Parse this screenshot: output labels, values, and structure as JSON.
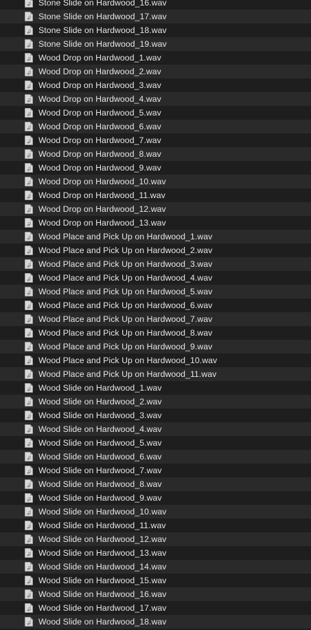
{
  "window": {
    "view": "list"
  },
  "files": [
    {
      "name": "Stone Slide on Hardwood_16.wav",
      "icon": "audio-file-icon"
    },
    {
      "name": "Stone Slide on Hardwood_17.wav",
      "icon": "audio-file-icon"
    },
    {
      "name": "Stone Slide on Hardwood_18.wav",
      "icon": "audio-file-icon"
    },
    {
      "name": "Stone Slide on Hardwood_19.wav",
      "icon": "audio-file-icon"
    },
    {
      "name": "Wood Drop on Hardwood_1.wav",
      "icon": "audio-file-icon"
    },
    {
      "name": "Wood Drop on Hardwood_2.wav",
      "icon": "audio-file-icon"
    },
    {
      "name": "Wood Drop on Hardwood_3.wav",
      "icon": "audio-file-icon"
    },
    {
      "name": "Wood Drop on Hardwood_4.wav",
      "icon": "audio-file-icon"
    },
    {
      "name": "Wood Drop on Hardwood_5.wav",
      "icon": "audio-file-icon"
    },
    {
      "name": "Wood Drop on Hardwood_6.wav",
      "icon": "audio-file-icon"
    },
    {
      "name": "Wood Drop on Hardwood_7.wav",
      "icon": "audio-file-icon"
    },
    {
      "name": "Wood Drop on Hardwood_8.wav",
      "icon": "audio-file-icon"
    },
    {
      "name": "Wood Drop on Hardwood_9.wav",
      "icon": "audio-file-icon"
    },
    {
      "name": "Wood Drop on Hardwood_10.wav",
      "icon": "audio-file-icon"
    },
    {
      "name": "Wood Drop on Hardwood_11.wav",
      "icon": "audio-file-icon"
    },
    {
      "name": "Wood Drop on Hardwood_12.wav",
      "icon": "audio-file-icon"
    },
    {
      "name": "Wood Drop on Hardwood_13.wav",
      "icon": "audio-file-icon"
    },
    {
      "name": "Wood Place and Pick Up on Hardwood_1.wav",
      "icon": "audio-file-icon"
    },
    {
      "name": "Wood Place and Pick Up on Hardwood_2.wav",
      "icon": "audio-file-icon"
    },
    {
      "name": "Wood Place and Pick Up on Hardwood_3.wav",
      "icon": "audio-file-icon"
    },
    {
      "name": "Wood Place and Pick Up on Hardwood_4.wav",
      "icon": "audio-file-icon"
    },
    {
      "name": "Wood Place and Pick Up on Hardwood_5.wav",
      "icon": "audio-file-icon"
    },
    {
      "name": "Wood Place and Pick Up on Hardwood_6.wav",
      "icon": "audio-file-icon"
    },
    {
      "name": "Wood Place and Pick Up on Hardwood_7.wav",
      "icon": "audio-file-icon"
    },
    {
      "name": "Wood Place and Pick Up on Hardwood_8.wav",
      "icon": "audio-file-icon"
    },
    {
      "name": "Wood Place and Pick Up on Hardwood_9.wav",
      "icon": "audio-file-icon"
    },
    {
      "name": "Wood Place and Pick Up on Hardwood_10.wav",
      "icon": "audio-file-icon"
    },
    {
      "name": "Wood Place and Pick Up on Hardwood_11.wav",
      "icon": "audio-file-icon"
    },
    {
      "name": "Wood Slide on Hardwood_1.wav",
      "icon": "audio-file-icon"
    },
    {
      "name": "Wood Slide on Hardwood_2.wav",
      "icon": "audio-file-icon"
    },
    {
      "name": "Wood Slide on Hardwood_3.wav",
      "icon": "audio-file-icon"
    },
    {
      "name": "Wood Slide on Hardwood_4.wav",
      "icon": "audio-file-icon"
    },
    {
      "name": "Wood Slide on Hardwood_5.wav",
      "icon": "audio-file-icon"
    },
    {
      "name": "Wood Slide on Hardwood_6.wav",
      "icon": "audio-file-icon"
    },
    {
      "name": "Wood Slide on Hardwood_7.wav",
      "icon": "audio-file-icon"
    },
    {
      "name": "Wood Slide on Hardwood_8.wav",
      "icon": "audio-file-icon"
    },
    {
      "name": "Wood Slide on Hardwood_9.wav",
      "icon": "audio-file-icon"
    },
    {
      "name": "Wood Slide on Hardwood_10.wav",
      "icon": "audio-file-icon"
    },
    {
      "name": "Wood Slide on Hardwood_11.wav",
      "icon": "audio-file-icon"
    },
    {
      "name": "Wood Slide on Hardwood_12.wav",
      "icon": "audio-file-icon"
    },
    {
      "name": "Wood Slide on Hardwood_13.wav",
      "icon": "audio-file-icon"
    },
    {
      "name": "Wood Slide on Hardwood_14.wav",
      "icon": "audio-file-icon"
    },
    {
      "name": "Wood Slide on Hardwood_15.wav",
      "icon": "audio-file-icon"
    },
    {
      "name": "Wood Slide on Hardwood_16.wav",
      "icon": "audio-file-icon"
    },
    {
      "name": "Wood Slide on Hardwood_17.wav",
      "icon": "audio-file-icon"
    },
    {
      "name": "Wood Slide on Hardwood_18.wav",
      "icon": "audio-file-icon"
    }
  ],
  "colors": {
    "background": "#1e1e1e",
    "row_alt": "#2a2a2b",
    "text": "#e6e6e6",
    "icon_body": "#d8d8d8",
    "icon_fold": "#a8a8a8",
    "icon_glyph": "#8a8a8a"
  }
}
